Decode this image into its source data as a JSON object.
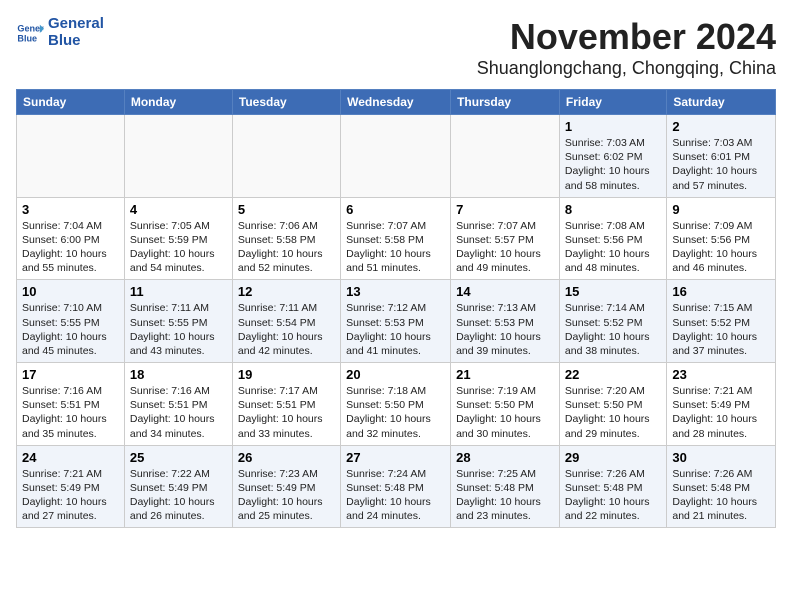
{
  "header": {
    "logo_line1": "General",
    "logo_line2": "Blue",
    "month_title": "November 2024",
    "location": "Shuanglongchang, Chongqing, China"
  },
  "weekdays": [
    "Sunday",
    "Monday",
    "Tuesday",
    "Wednesday",
    "Thursday",
    "Friday",
    "Saturday"
  ],
  "weeks": [
    [
      {
        "day": "",
        "info": ""
      },
      {
        "day": "",
        "info": ""
      },
      {
        "day": "",
        "info": ""
      },
      {
        "day": "",
        "info": ""
      },
      {
        "day": "",
        "info": ""
      },
      {
        "day": "1",
        "info": "Sunrise: 7:03 AM\nSunset: 6:02 PM\nDaylight: 10 hours and 58 minutes."
      },
      {
        "day": "2",
        "info": "Sunrise: 7:03 AM\nSunset: 6:01 PM\nDaylight: 10 hours and 57 minutes."
      }
    ],
    [
      {
        "day": "3",
        "info": "Sunrise: 7:04 AM\nSunset: 6:00 PM\nDaylight: 10 hours and 55 minutes."
      },
      {
        "day": "4",
        "info": "Sunrise: 7:05 AM\nSunset: 5:59 PM\nDaylight: 10 hours and 54 minutes."
      },
      {
        "day": "5",
        "info": "Sunrise: 7:06 AM\nSunset: 5:58 PM\nDaylight: 10 hours and 52 minutes."
      },
      {
        "day": "6",
        "info": "Sunrise: 7:07 AM\nSunset: 5:58 PM\nDaylight: 10 hours and 51 minutes."
      },
      {
        "day": "7",
        "info": "Sunrise: 7:07 AM\nSunset: 5:57 PM\nDaylight: 10 hours and 49 minutes."
      },
      {
        "day": "8",
        "info": "Sunrise: 7:08 AM\nSunset: 5:56 PM\nDaylight: 10 hours and 48 minutes."
      },
      {
        "day": "9",
        "info": "Sunrise: 7:09 AM\nSunset: 5:56 PM\nDaylight: 10 hours and 46 minutes."
      }
    ],
    [
      {
        "day": "10",
        "info": "Sunrise: 7:10 AM\nSunset: 5:55 PM\nDaylight: 10 hours and 45 minutes."
      },
      {
        "day": "11",
        "info": "Sunrise: 7:11 AM\nSunset: 5:55 PM\nDaylight: 10 hours and 43 minutes."
      },
      {
        "day": "12",
        "info": "Sunrise: 7:11 AM\nSunset: 5:54 PM\nDaylight: 10 hours and 42 minutes."
      },
      {
        "day": "13",
        "info": "Sunrise: 7:12 AM\nSunset: 5:53 PM\nDaylight: 10 hours and 41 minutes."
      },
      {
        "day": "14",
        "info": "Sunrise: 7:13 AM\nSunset: 5:53 PM\nDaylight: 10 hours and 39 minutes."
      },
      {
        "day": "15",
        "info": "Sunrise: 7:14 AM\nSunset: 5:52 PM\nDaylight: 10 hours and 38 minutes."
      },
      {
        "day": "16",
        "info": "Sunrise: 7:15 AM\nSunset: 5:52 PM\nDaylight: 10 hours and 37 minutes."
      }
    ],
    [
      {
        "day": "17",
        "info": "Sunrise: 7:16 AM\nSunset: 5:51 PM\nDaylight: 10 hours and 35 minutes."
      },
      {
        "day": "18",
        "info": "Sunrise: 7:16 AM\nSunset: 5:51 PM\nDaylight: 10 hours and 34 minutes."
      },
      {
        "day": "19",
        "info": "Sunrise: 7:17 AM\nSunset: 5:51 PM\nDaylight: 10 hours and 33 minutes."
      },
      {
        "day": "20",
        "info": "Sunrise: 7:18 AM\nSunset: 5:50 PM\nDaylight: 10 hours and 32 minutes."
      },
      {
        "day": "21",
        "info": "Sunrise: 7:19 AM\nSunset: 5:50 PM\nDaylight: 10 hours and 30 minutes."
      },
      {
        "day": "22",
        "info": "Sunrise: 7:20 AM\nSunset: 5:50 PM\nDaylight: 10 hours and 29 minutes."
      },
      {
        "day": "23",
        "info": "Sunrise: 7:21 AM\nSunset: 5:49 PM\nDaylight: 10 hours and 28 minutes."
      }
    ],
    [
      {
        "day": "24",
        "info": "Sunrise: 7:21 AM\nSunset: 5:49 PM\nDaylight: 10 hours and 27 minutes."
      },
      {
        "day": "25",
        "info": "Sunrise: 7:22 AM\nSunset: 5:49 PM\nDaylight: 10 hours and 26 minutes."
      },
      {
        "day": "26",
        "info": "Sunrise: 7:23 AM\nSunset: 5:49 PM\nDaylight: 10 hours and 25 minutes."
      },
      {
        "day": "27",
        "info": "Sunrise: 7:24 AM\nSunset: 5:48 PM\nDaylight: 10 hours and 24 minutes."
      },
      {
        "day": "28",
        "info": "Sunrise: 7:25 AM\nSunset: 5:48 PM\nDaylight: 10 hours and 23 minutes."
      },
      {
        "day": "29",
        "info": "Sunrise: 7:26 AM\nSunset: 5:48 PM\nDaylight: 10 hours and 22 minutes."
      },
      {
        "day": "30",
        "info": "Sunrise: 7:26 AM\nSunset: 5:48 PM\nDaylight: 10 hours and 21 minutes."
      }
    ]
  ]
}
